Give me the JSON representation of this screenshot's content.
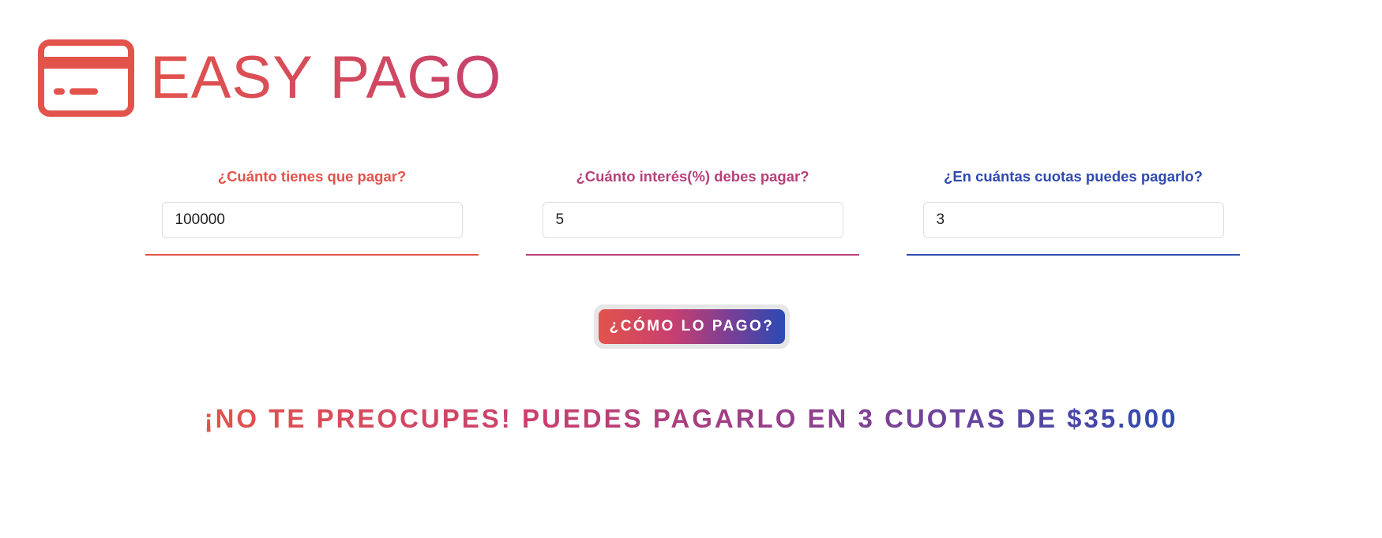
{
  "app": {
    "title": "EASY PAGO",
    "logo_icon": "credit-card-icon"
  },
  "colors": {
    "red": "#e2534c",
    "magenta": "#b8407a",
    "blue": "#2f4ab0",
    "input_border": "#dedede",
    "button_ring": "#e6e6e6"
  },
  "form": {
    "fields": [
      {
        "label": "¿Cuánto tienes que pagar?",
        "value": "100000",
        "color": "#e2534c"
      },
      {
        "label": "¿Cuánto interés(%) debes pagar?",
        "value": "5",
        "color": "#b8407a"
      },
      {
        "label": "¿En cuántas cuotas puedes pagarlo?",
        "value": "3",
        "color": "#2f4ab0"
      }
    ],
    "submit_label": "¿CÓMO LO PAGO?"
  },
  "result": {
    "message": "¡NO TE PREOCUPES! PUEDES PAGARLO EN 3 CUOTAS DE $35.000"
  }
}
